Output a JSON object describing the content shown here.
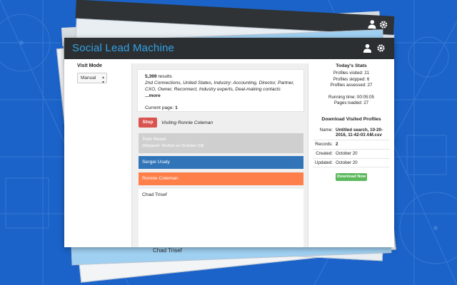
{
  "app": {
    "title": "Social Lead Machine"
  },
  "icons": {
    "user": "user-icon",
    "settings": "gear-icon"
  },
  "colors": {
    "title_accent": "#32a2e6",
    "stop": "#d9534f",
    "active_profile": "#3175b8",
    "current_profile": "#ff7f4a",
    "download": "#5cb85c",
    "background": "#1b63c9"
  },
  "left": {
    "visit_mode_label": "Visit Mode",
    "visit_mode_value": "Manual"
  },
  "results": {
    "count": "5,399",
    "count_suffix": " results",
    "filters": "2nd Connections, United States, Industry: Accounting, Director, Partner, CXO, Owner, Reconnect, Industry experts, Deal-making contacts",
    "more": "...more",
    "current_page_label": "Current page: ",
    "current_page": "1"
  },
  "actions": {
    "stop": "Stop",
    "visiting": "Visiting Ronnie Coleman"
  },
  "profiles": [
    {
      "name": "Tom Hood",
      "note": "(Skipped: Visited on October 19)",
      "state": "skipped"
    },
    {
      "name": "Sergei Usaty",
      "state": "active"
    },
    {
      "name": "Ronnie Coleman",
      "state": "current"
    },
    {
      "name": "Chad Trisef",
      "state": "pending"
    }
  ],
  "today_stats": {
    "title": "Today's Stats",
    "profiles_visited": "Profiles visited: 21",
    "profiles_skipped": "Profiles skipped: 6",
    "profiles_assessed": "Profiles assessed: 27",
    "running_time": "Running time: 00:05:05",
    "pages_loaded": "Pages loaded: 27"
  },
  "download": {
    "title": "Download Visited Profiles",
    "name_label": "Name:",
    "name_value": "Untitled search, 10-20-2016, 11-42-03 AM.csv",
    "records_label": "Records:",
    "records_value": "2",
    "created_label": "Created:",
    "created_value": "October 20",
    "updated_label": "Updated:",
    "updated_value": "October 20",
    "button": "Download Now"
  },
  "ghost": {
    "chad_overlay": "Chad Trisef"
  }
}
